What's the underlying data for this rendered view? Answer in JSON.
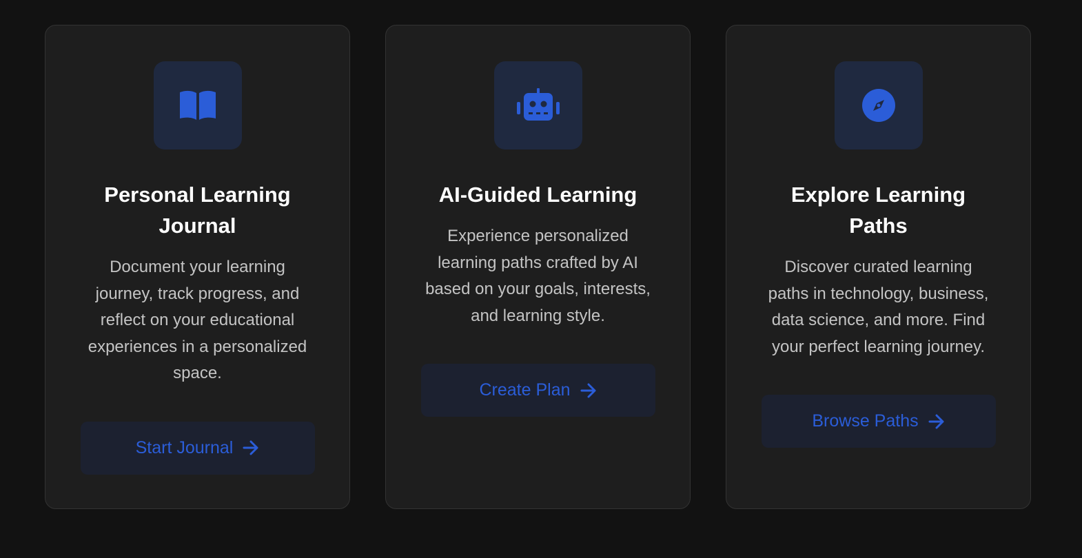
{
  "accent_color": "#2b5dd8",
  "cards": [
    {
      "icon": "book-open-icon",
      "title": "Personal Learning Journal",
      "description": "Document your learning journey, track progress, and reflect on your educational experiences in a personalized space.",
      "button_label": "Start Journal",
      "button_icon": "arrow-right-icon"
    },
    {
      "icon": "robot-icon",
      "title": "AI-Guided Learning",
      "description": "Experience personalized learning paths crafted by AI based on your goals, interests, and learning style.",
      "button_label": "Create Plan",
      "button_icon": "arrow-right-icon"
    },
    {
      "icon": "compass-icon",
      "title": "Explore Learning Paths",
      "description": "Discover curated learning paths in technology, business, data science, and more. Find your perfect learning journey.",
      "button_label": "Browse Paths",
      "button_icon": "arrow-right-icon"
    }
  ]
}
